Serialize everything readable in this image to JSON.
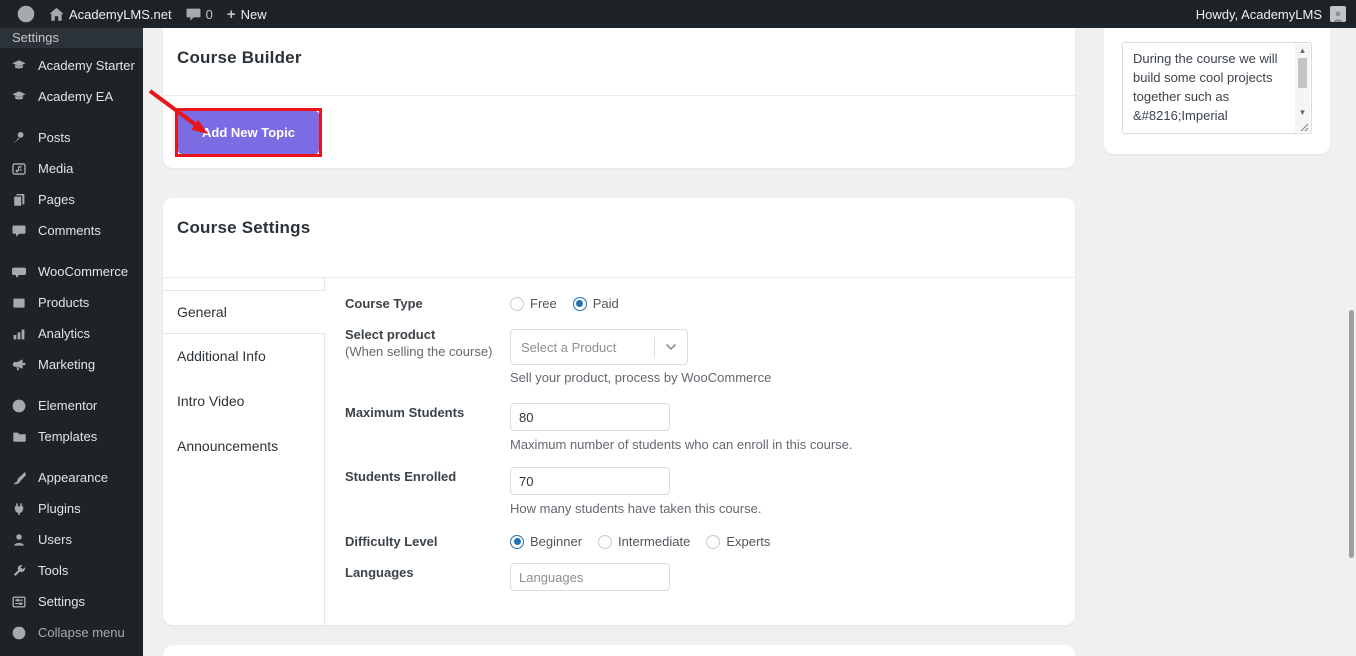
{
  "admin_bar": {
    "site_name": "AcademyLMS.net",
    "comments_count": "0",
    "new_label": "New",
    "howdy": "Howdy, AcademyLMS"
  },
  "sidebar": {
    "submenu_header": "Settings",
    "items": [
      {
        "label": "Academy Starter",
        "icon": "graduation-cap-icon"
      },
      {
        "label": "Academy EA",
        "icon": "graduation-cap-icon"
      },
      {
        "label": "Posts",
        "icon": "pushpin-icon"
      },
      {
        "label": "Media",
        "icon": "media-icon"
      },
      {
        "label": "Pages",
        "icon": "pages-icon"
      },
      {
        "label": "Comments",
        "icon": "comment-icon"
      },
      {
        "label": "WooCommerce",
        "icon": "woocommerce-icon"
      },
      {
        "label": "Products",
        "icon": "products-icon"
      },
      {
        "label": "Analytics",
        "icon": "analytics-icon"
      },
      {
        "label": "Marketing",
        "icon": "megaphone-icon"
      },
      {
        "label": "Elementor",
        "icon": "elementor-icon"
      },
      {
        "label": "Templates",
        "icon": "folder-icon"
      },
      {
        "label": "Appearance",
        "icon": "brush-icon"
      },
      {
        "label": "Plugins",
        "icon": "plug-icon"
      },
      {
        "label": "Users",
        "icon": "user-icon"
      },
      {
        "label": "Tools",
        "icon": "wrench-icon"
      },
      {
        "label": "Settings",
        "icon": "sliders-icon"
      },
      {
        "label": "Collapse menu",
        "icon": "collapse-icon"
      }
    ]
  },
  "course_builder": {
    "title": "Course Builder",
    "add_button": "Add New Topic"
  },
  "course_settings": {
    "title": "Course Settings",
    "tabs": [
      "General",
      "Additional Info",
      "Intro Video",
      "Announcements"
    ],
    "active_tab": "General",
    "fields": {
      "course_type": {
        "label": "Course Type",
        "options": [
          "Free",
          "Paid"
        ],
        "selected": "Paid"
      },
      "select_product": {
        "label": "Select product",
        "sublabel": "(When selling the course)",
        "placeholder": "Select a Product",
        "help": "Sell your product, process by WooCommerce"
      },
      "maximum_students": {
        "label": "Maximum Students",
        "value": "80",
        "help": "Maximum number of students who can enroll in this course."
      },
      "students_enrolled": {
        "label": "Students Enrolled",
        "value": "70",
        "help": "How many students have taken this course."
      },
      "difficulty_level": {
        "label": "Difficulty Level",
        "options": [
          "Beginner",
          "Intermediate",
          "Experts"
        ],
        "selected": "Beginner"
      },
      "languages": {
        "label": "Languages",
        "placeholder": "Languages"
      }
    }
  },
  "excerpt_box": {
    "lines": [
      "During the course we will",
      "build some cool projects",
      "together such as",
      "&#8216;Imperial"
    ]
  },
  "colors": {
    "accent_purple": "#7b6ce4",
    "highlight_red": "#e8151b",
    "radio_blue": "#2271b1",
    "admin_dark": "#1d2327"
  }
}
